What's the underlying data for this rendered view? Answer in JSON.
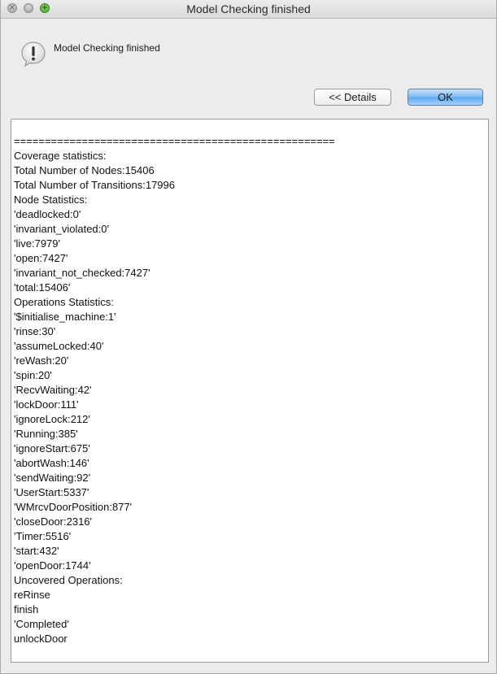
{
  "window": {
    "title": "Model Checking finished"
  },
  "dialog": {
    "message": "Model Checking finished",
    "details_label": "<< Details",
    "ok_label": "OK"
  },
  "report": {
    "lines": [
      "====================================================",
      "Coverage statistics:",
      "Total Number of Nodes:15406",
      "Total Number of Transitions:17996",
      "Node Statistics:",
      "'deadlocked:0'",
      "'invariant_violated:0'",
      "'live:7979'",
      "'open:7427'",
      "'invariant_not_checked:7427'",
      "'total:15406'",
      "Operations Statistics:",
      "'$initialise_machine:1'",
      "'rinse:30'",
      "'assumeLocked:40'",
      "'reWash:20'",
      "'spin:20'",
      "'RecvWaiting:42'",
      "'lockDoor:111'",
      "'ignoreLock:212'",
      "'Running:385'",
      "'ignoreStart:675'",
      "'abortWash:146'",
      "'sendWaiting:92'",
      "'UserStart:5337'",
      "'WMrcvDoorPosition:877'",
      "'closeDoor:2316'",
      "'Timer:5516'",
      "'start:432'",
      "'openDoor:1744'",
      "Uncovered Operations:",
      "reRinse",
      "finish",
      "'Completed'",
      "unlockDoor"
    ]
  },
  "icons": {
    "close": "close-icon",
    "minimize": "minimize-icon",
    "zoom": "zoom-plus-icon",
    "alert": "exclamation-bubble-icon"
  },
  "colors": {
    "ok_button": "#7fbaf3",
    "zoom_button": "#3aa320"
  }
}
